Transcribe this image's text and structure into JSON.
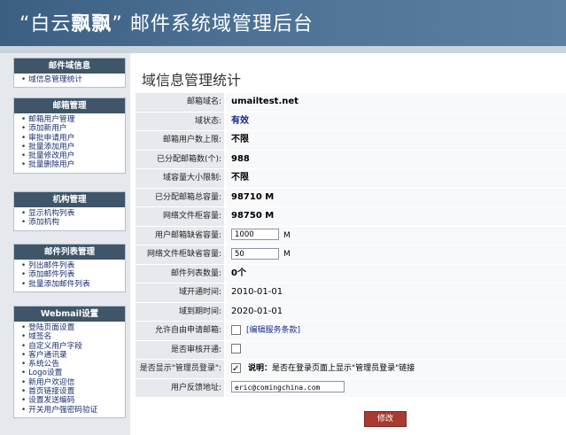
{
  "header": {
    "title_part1": "“白云",
    "title_bold": "飘飘",
    "title_part2": "” 邮件系统域管理后台"
  },
  "sidebar": {
    "sections": [
      {
        "title": "邮件域信息",
        "items": [
          "域信息管理统计"
        ]
      },
      {
        "title": "邮箱管理",
        "items": [
          "邮箱用户管理",
          "添加新用户",
          "审批申请用户",
          "批量添加用户",
          "批量修改用户",
          "批量删除用户"
        ]
      },
      {
        "title": "机构管理",
        "items": [
          "显示机构列表",
          "添加机构"
        ]
      },
      {
        "title": "邮件列表管理",
        "items": [
          "列出邮件列表",
          "添加邮件列表",
          "批量添加邮件列表"
        ]
      },
      {
        "title": "Webmail设置",
        "items": [
          "登陆页面设置",
          "域签名",
          "自定义用户字段",
          "客户通讯录",
          "系统公告",
          "Logo设置",
          "新用户欢迎信",
          "首页链接设置",
          "设置发送编码",
          "开关用户强密码验证"
        ]
      }
    ]
  },
  "main": {
    "title": "域信息管理统计",
    "fields": {
      "domain_name": {
        "label": "邮箱域名:",
        "value": "umailtest.net"
      },
      "domain_status": {
        "label": "域状态:",
        "value": "有效"
      },
      "user_limit": {
        "label": "邮箱用户数上限:",
        "value": "不限"
      },
      "allocated_count": {
        "label": "已分配邮箱数(个):",
        "value": "988"
      },
      "domain_capacity": {
        "label": "域容量大小限制:",
        "value": "不限"
      },
      "allocated_capacity": {
        "label": "已分配邮箱总容量:",
        "value": "98710 M"
      },
      "netdisk_capacity": {
        "label": "网络文件柜容量:",
        "value": "98750 M"
      },
      "default_mailbox": {
        "label": "用户邮箱缺省容量:",
        "value": "1000",
        "unit": "M"
      },
      "default_netdisk": {
        "label": "网络文件柜缺省容量:",
        "value": "50",
        "unit": "M"
      },
      "mailing_lists": {
        "label": "邮件列表数量:",
        "value": "0个"
      },
      "open_date": {
        "label": "域开通时间:",
        "value": "2010-01-01"
      },
      "expire_date": {
        "label": "域到期时间:",
        "value": "2020-01-01"
      },
      "free_register": {
        "label": "允许自由申请邮箱:",
        "checked": false,
        "link": "[编辑服务条款]"
      },
      "need_review": {
        "label": "是否审核开通:",
        "checked": false
      },
      "show_admin_login": {
        "label": "是否显示\"管理员登录\":",
        "checked": true,
        "note_bold": "说明：",
        "note": "是否在登录页面上显示\"管理员登录\"链接"
      },
      "feedback_address": {
        "label": "用户反馈地址:",
        "value": "eric@comingchina.com"
      }
    },
    "submit_label": "修改"
  }
}
